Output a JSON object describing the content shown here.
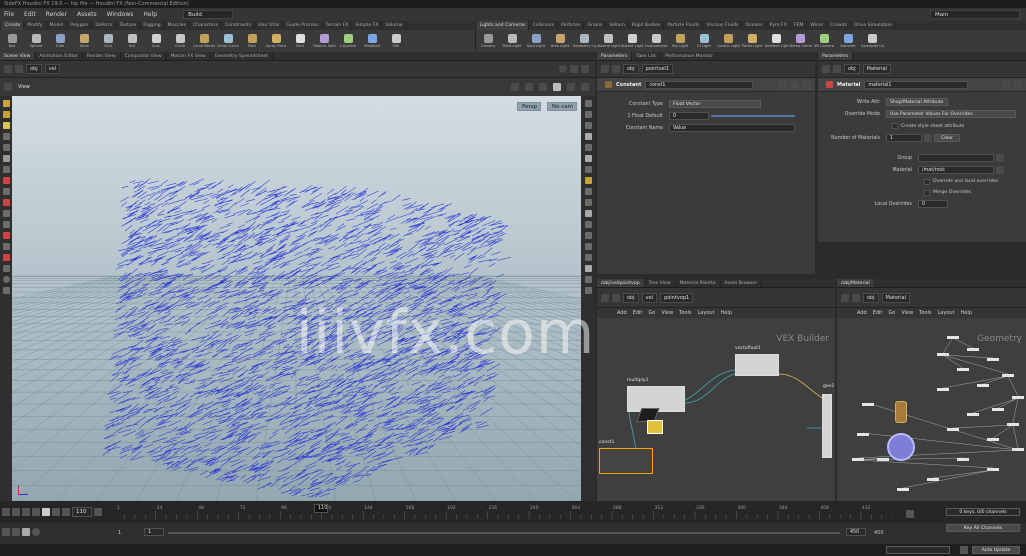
{
  "window": {
    "title": "SideFX Houdini FX 19.0 — hip file — Houdini FX (Non-Commercial Edition)"
  },
  "menubar": {
    "items": [
      "File",
      "Edit",
      "Render",
      "Assets",
      "Windows",
      "Help"
    ],
    "desktop": "Build",
    "workspace": "Main"
  },
  "shelf": {
    "tabs_left": [
      "Create",
      "Modify",
      "Model",
      "Polygon",
      "Deform",
      "Texture",
      "Rigging",
      "Muscles",
      "Characters",
      "Constraints",
      "Hair Utils",
      "Guide Process",
      "Terrain FX",
      "Simple FX",
      "Volume"
    ],
    "tabs_right": [
      "Lights and Cameras",
      "Collisions",
      "Particles",
      "Grains",
      "Vellum",
      "Rigid Bodies",
      "Particle Fluids",
      "Viscous Fluids",
      "Oceans",
      "Pyro FX",
      "FEM",
      "Wires",
      "Crowds",
      "Drive Simulation"
    ],
    "tools_left": [
      "Box",
      "Sphere",
      "Tube",
      "Torus",
      "Grid",
      "Null",
      "Line",
      "Circle",
      "Curve Bezier",
      "Draw Curve",
      "Path",
      "Spray Paint",
      "Font",
      "Platonic Solids",
      "L-System",
      "Metaball",
      "File"
    ],
    "tools_right": [
      "Camera",
      "Point Light",
      "Spot Light",
      "Area Light",
      "Geometry Light",
      "Volume Light",
      "Distant Light",
      "Environment Light",
      "Sky Light",
      "GI Light",
      "Caustic Light",
      "Portal Light",
      "Ambient Light",
      "Stereo Camera",
      "VR Camera",
      "Switcher",
      "Gamepad Camera"
    ]
  },
  "viewport_pane": {
    "tabs": [
      "Scene View",
      "Animation Editor",
      "Render View",
      "Composite View",
      "Motion FX View",
      "Geometry Spreadsheet"
    ],
    "path": [
      "obj",
      "vel"
    ],
    "view_label": "View",
    "camera_menu": "Persp",
    "cam_menu": "No cam"
  },
  "param_pane": {
    "tabs": [
      "Parameters",
      "Take List",
      "Performance Monitor"
    ],
    "path": [
      "obj",
      "pointvel1"
    ],
    "node_type": "Constant",
    "node_name": "const1",
    "rows": [
      {
        "label": "Constant Type",
        "value": "Float Vector"
      },
      {
        "label": "1 Float Default",
        "value": "0"
      },
      {
        "label": "Constant Name",
        "value": "Value"
      }
    ]
  },
  "material_pane": {
    "tabs": [
      "Parameters"
    ],
    "path": [
      "obj",
      "Material"
    ],
    "node_type": "Material",
    "node_name": "material1",
    "rows": [
      {
        "label": "Write Attr",
        "value": "Shop/Material Attribute"
      },
      {
        "label": "Override Mode",
        "value": "Use Parameter Values For Overrides"
      },
      {
        "label": "",
        "value": "Create style sheet attribute"
      },
      {
        "label": "Number of Materials",
        "value": "1"
      },
      {
        "label": "Group",
        "value": ""
      },
      {
        "label": "Material",
        "value": "/mat/rock"
      },
      {
        "label": "",
        "value": "Override and local overrides"
      },
      {
        "label": "",
        "value": "Merge Overrides"
      },
      {
        "label": "Local Overrides",
        "value": "0"
      }
    ],
    "clear_label": "Clear"
  },
  "vop_network": {
    "tabs": [
      "/obj/vel/pointvop",
      "Tree View",
      "Material Palette",
      "Asset Browser"
    ],
    "path": [
      "obj",
      "vel",
      "pointvop1"
    ],
    "menu": [
      "Add",
      "Edit",
      "Go",
      "View",
      "Tools",
      "Layout",
      "Help"
    ],
    "watermark": "VEX Builder",
    "nodes": [
      "vectofloat1",
      "multiply1",
      "const1",
      "geo1"
    ]
  },
  "sop_network": {
    "tabs": [
      "/obj/Material"
    ],
    "path": [
      "obj",
      "Material"
    ],
    "menu": [
      "Add",
      "Edit",
      "Go",
      "View",
      "Tools",
      "Layout",
      "Help"
    ],
    "watermark": "Geometry"
  },
  "timeline": {
    "frame": "110",
    "ticks": [
      "1",
      "24",
      "48",
      "72",
      "96",
      "120",
      "144",
      "168",
      "192",
      "216",
      "240",
      "264",
      "288",
      "312",
      "336",
      "360",
      "384",
      "408",
      "432"
    ],
    "current_marker": "110",
    "start": "1",
    "start2": "1",
    "end": "450",
    "end2": "450"
  },
  "right_buttons": {
    "keys": "0 keys, 0/0 channels",
    "key_all": "Key All Channels",
    "auto_update": "Auto Update"
  },
  "watermark": "iiivfx.com",
  "colors": {
    "arrows": "#1f2bd6",
    "accent": "#f0a500"
  }
}
